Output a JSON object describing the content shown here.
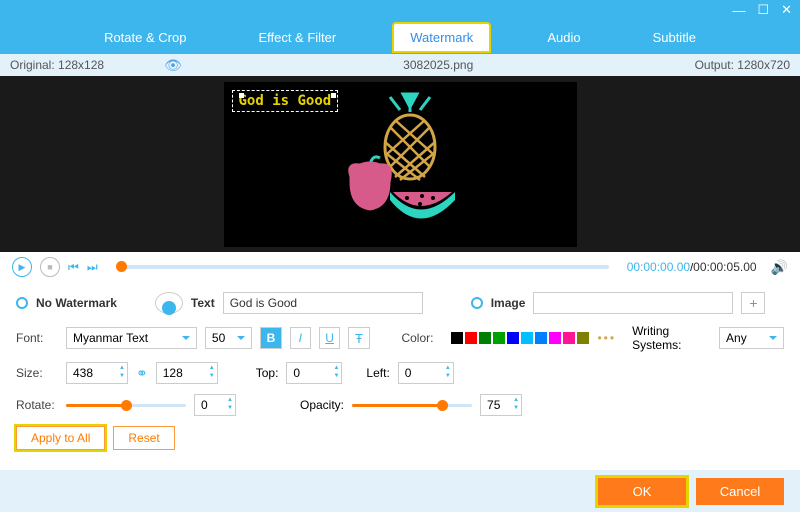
{
  "titlebar": {
    "min": "—",
    "max": "☐",
    "close": "✕"
  },
  "tabs": [
    "Rotate & Crop",
    "Effect & Filter",
    "Watermark",
    "Audio",
    "Subtitle"
  ],
  "active_tab": 2,
  "infobar": {
    "original": "Original: 128x128",
    "filename": "3082025.png",
    "output": "Output: 1280x720"
  },
  "watermark_text": "God is Good",
  "transport": {
    "current": "00:00:00.00",
    "duration": "00:00:05.00"
  },
  "opts": {
    "no_watermark": "No Watermark",
    "text_label": "Text",
    "text_value": "God is Good",
    "image_label": "Image",
    "image_value": "",
    "font_label": "Font:",
    "font_value": "Myanmar Text",
    "fontsize_value": "50",
    "color_label": "Color:",
    "ws_label": "Writing Systems:",
    "ws_value": "Any",
    "size_label": "Size:",
    "size_w": "438",
    "size_h": "128",
    "top_label": "Top:",
    "top_v": "0",
    "left_label": "Left:",
    "left_v": "0",
    "rotate_label": "Rotate:",
    "rotate_v": "0",
    "rotate_pct": 50,
    "opacity_label": "Opacity:",
    "opacity_v": "75",
    "opacity_pct": 75,
    "apply": "Apply to All",
    "reset": "Reset"
  },
  "colors": [
    "#000000",
    "#ff0000",
    "#008000",
    "#00a000",
    "#0000ff",
    "#00bfff",
    "#0080ff",
    "#ff00ff",
    "#ff1493",
    "#808000"
  ],
  "footer": {
    "ok": "OK",
    "cancel": "Cancel"
  }
}
